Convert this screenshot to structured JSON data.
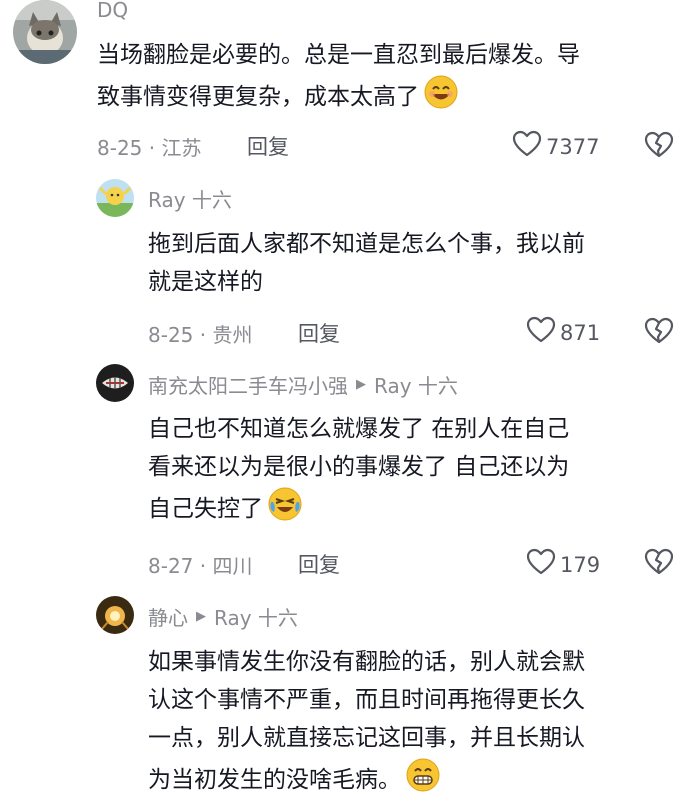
{
  "comments": [
    {
      "user": "DQ",
      "reply_to": "",
      "text_lines": [
        "当场翻脸是必要的。总是一直忍到最后爆发。导",
        "致事情变得更复杂，成本太高了"
      ],
      "emoji": "smile-emoji",
      "meta": "8-25 · 江苏",
      "reply_label": "回复",
      "likes": "7377"
    },
    {
      "user": "Ray 十六",
      "reply_to": "",
      "text_lines": [
        "拖到后面人家都不知道是怎么个事，我以前",
        "就是这样的"
      ],
      "emoji": "",
      "meta": "8-25 · 贵州",
      "reply_label": "回复",
      "likes": "871"
    },
    {
      "user": "南充太阳二手车冯小强",
      "reply_to": "Ray 十六",
      "text_lines": [
        "自己也不知道怎么就爆发了  在别人在自己",
        "看来还以为是很小的事爆发了  自己还以为",
        "自己失控了"
      ],
      "emoji": "crying-laugh-emoji",
      "meta": "8-27 · 四川",
      "reply_label": "回复",
      "likes": "179"
    },
    {
      "user": "静心",
      "reply_to": "Ray 十六",
      "text_lines": [
        "如果事情发生你没有翻脸的话，别人就会默",
        "认这个事情不严重，而且时间再拖得更长久",
        "一点，别人就直接忘记这回事，并且长期认",
        "为当初发生的没啥毛病。"
      ],
      "emoji": "grin-emoji",
      "meta": "",
      "reply_label": "",
      "likes": ""
    }
  ],
  "colors": {
    "text": "#161823",
    "secondary": "#8a8b91",
    "action": "#555861",
    "emoji": "#f7c531"
  }
}
